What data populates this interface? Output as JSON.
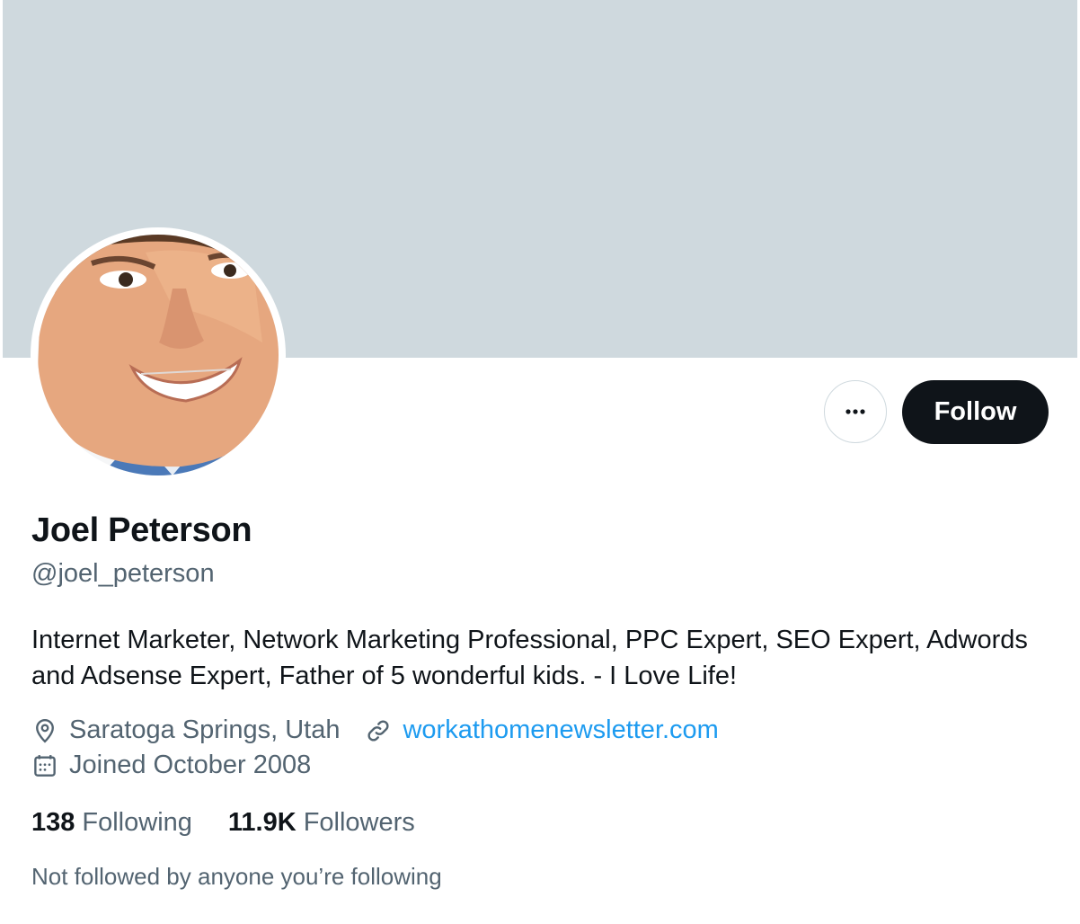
{
  "profile": {
    "display_name": "Joel Peterson",
    "handle": "@joel_peterson",
    "bio": "Internet Marketer, Network Marketing Professional, PPC Expert, SEO Expert, Adwords and Adsense Expert, Father of 5 wonderful kids. - I Love Life!",
    "location": "Saratoga Springs, Utah",
    "website": "workathomenewsletter.com",
    "joined": "Joined October 2008"
  },
  "actions": {
    "more_icon": "more-horizontal-icon",
    "follow_label": "Follow"
  },
  "stats": {
    "following_count": "138",
    "following_label": "Following",
    "followers_count": "11.9K",
    "followers_label": "Followers"
  },
  "mutual_text": "Not followed by anyone you’re following",
  "icons": {
    "location": "location-pin-icon",
    "link": "link-icon",
    "calendar": "calendar-icon"
  },
  "colors": {
    "banner": "#cfd9de",
    "text_primary": "#0f1419",
    "text_secondary": "#536471",
    "link": "#1d9bf0",
    "follow_button_bg": "#0f1419"
  }
}
